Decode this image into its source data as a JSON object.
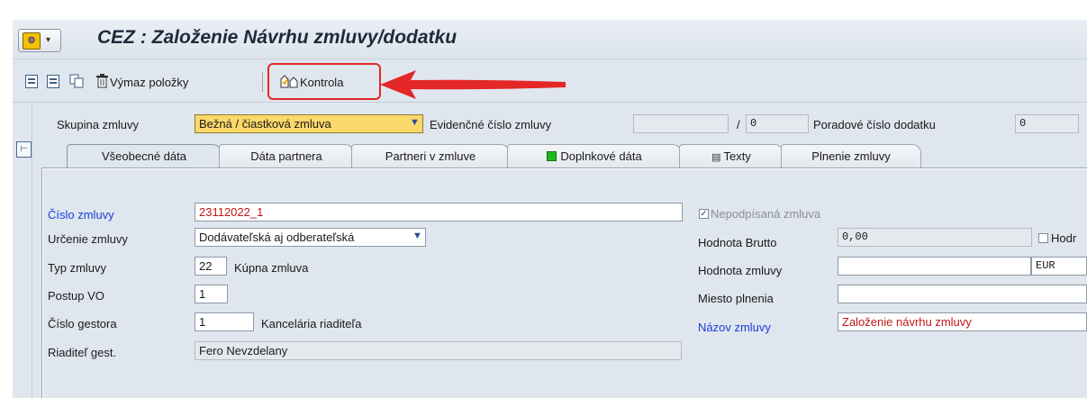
{
  "title": "CEZ : Založenie Návrhu zmluvy/dodatku",
  "toolbar": {
    "delete_item_label": "Výmaz položky",
    "check_label": "Kontrola"
  },
  "header": {
    "contract_group_label": "Skupina zmluvy",
    "contract_group_value": "Bežná / čiastková zmluva",
    "registry_number_label": "Evidenčné číslo zmluvy",
    "registry_number_value": "",
    "registry_number_slash": "/",
    "registry_number_suffix": "0",
    "amendment_number_label": "Poradové číslo dodatku",
    "amendment_number_value": "0"
  },
  "tabs": [
    {
      "label": "Všeobecné dáta",
      "active": true
    },
    {
      "label": "Dáta partnera"
    },
    {
      "label": "Partneri v zmluve"
    },
    {
      "label": "Doplnkové dáta"
    },
    {
      "label": "Texty"
    },
    {
      "label": "Plnenie zmluvy"
    }
  ],
  "form": {
    "contract_number_label": "Číslo zmluvy",
    "contract_number_value": "23112022_1",
    "contract_purpose_label": "Určenie zmluvy",
    "contract_purpose_value": "Dodávateľská aj odberateľská",
    "contract_type_label": "Typ zmluvy",
    "contract_type_code": "22",
    "contract_type_text": "Kúpna zmluva",
    "procedure_label": "Postup VO",
    "procedure_value": "1",
    "guarantor_number_label": "Číslo gestora",
    "guarantor_number_value": "1",
    "guarantor_text": "Kancelária riaditeľa",
    "director_label": "Riaditeľ gest.",
    "director_value": "Fero Nevzdelany",
    "unsigned_label": "Nepodpísaná zmluva",
    "unsigned_checked": true,
    "gross_value_label": "Hodnota Brutto",
    "gross_value_value": "0,00",
    "gross_checkbox_label": "Hodr",
    "contract_value_label": "Hodnota zmluvy",
    "contract_value_value": "",
    "currency_value": "EUR",
    "place_label": "Miesto plnenia",
    "place_value": "",
    "contract_name_label": "Názov zmluvy",
    "contract_name_value": "Založenie návrhu zmluvy"
  },
  "colors": {
    "highlight": "#e42727",
    "required_label": "#1a3fd6",
    "value_red": "#c21515",
    "dropdown_bg": "#fbd86a"
  },
  "icons": [
    "sap-menu-icon",
    "save-icon",
    "detail-icon",
    "copy-icon",
    "trash-icon",
    "check-icon",
    "side-toggle-icon",
    "dropdown-arrow-icon",
    "green-square-icon",
    "texts-icon"
  ]
}
